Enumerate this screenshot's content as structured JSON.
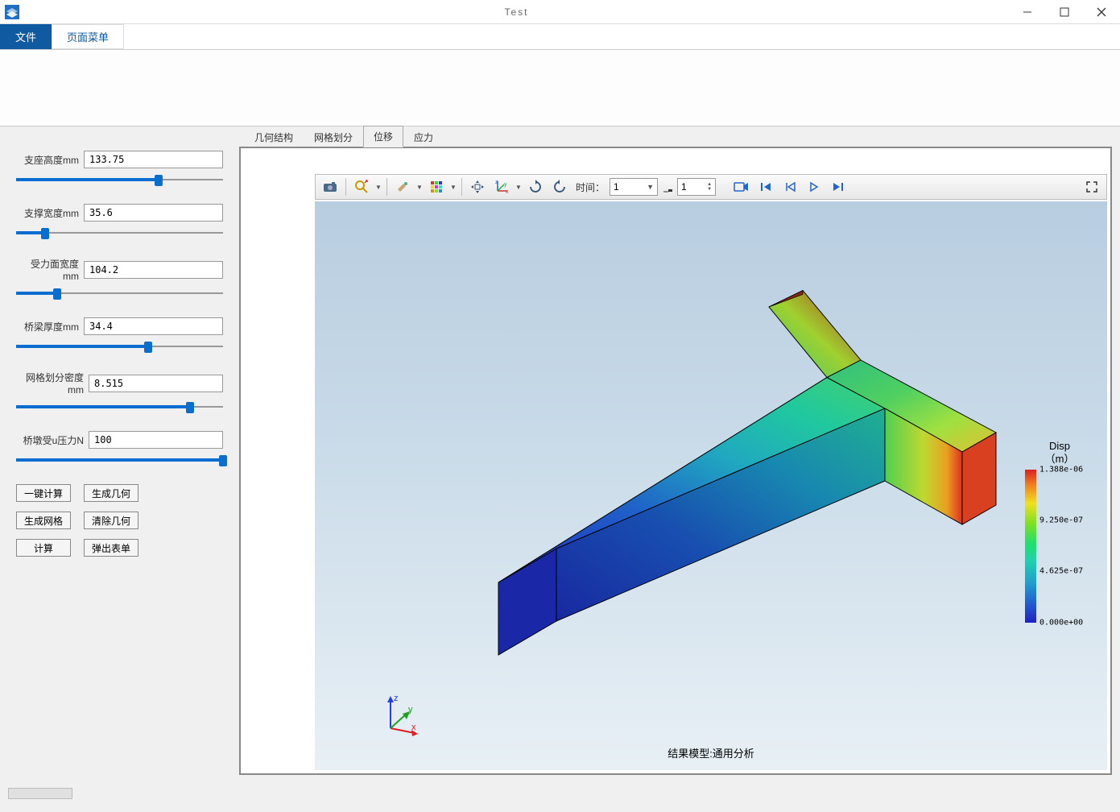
{
  "window": {
    "title": "Test"
  },
  "menu": {
    "file": "文件",
    "page_menu": "页面菜单"
  },
  "params": {
    "seat_height": {
      "label": "支座高度mm",
      "value": "133.75",
      "pct": 67
    },
    "support_width": {
      "label": "支撑宽度mm",
      "value": "35.6",
      "pct": 12
    },
    "force_face_width": {
      "label": "受力面宽度mm",
      "value": "104.2",
      "pct": 18
    },
    "beam_thickness": {
      "label": "桥梁厚度mm",
      "value": "34.4",
      "pct": 62
    },
    "mesh_density": {
      "label": "网格划分密度mm",
      "value": "8.515",
      "pct": 82
    },
    "pier_pressure": {
      "label": "桥墩受u压力N",
      "value": "100",
      "pct": 99
    }
  },
  "buttons": {
    "one_click_calc": "一键计算",
    "gen_geom": "生成几何",
    "gen_mesh": "生成网格",
    "clear_geom": "清除几何",
    "calc": "计算",
    "popup_table": "弹出表单"
  },
  "subtabs": {
    "geometry": "几何结构",
    "mesh": "网格划分",
    "displacement": "位移",
    "stress": "应力"
  },
  "toolbar": {
    "time_label": "时间：",
    "time_value": "1",
    "time_spin": "1"
  },
  "viewport": {
    "footer": "结果模型:通用分析",
    "triad": {
      "x": "x",
      "y": "y",
      "z": "z"
    }
  },
  "legend": {
    "title_l1": "Disp",
    "title_l2": "（m）",
    "v0": "1.388e-06",
    "v1": "9.250e-07",
    "v2": "4.625e-07",
    "v3": "0.000e+00"
  },
  "chart_data": {
    "type": "heatmap",
    "title": "Disp (m)",
    "colorbar": {
      "min": 0.0,
      "max": 1.388e-06,
      "ticks": [
        0.0,
        4.625e-07,
        9.25e-07,
        1.388e-06
      ],
      "colormap": "rainbow"
    },
    "model_label": "结果模型:通用分析",
    "axes": [
      "x",
      "y",
      "z"
    ]
  }
}
